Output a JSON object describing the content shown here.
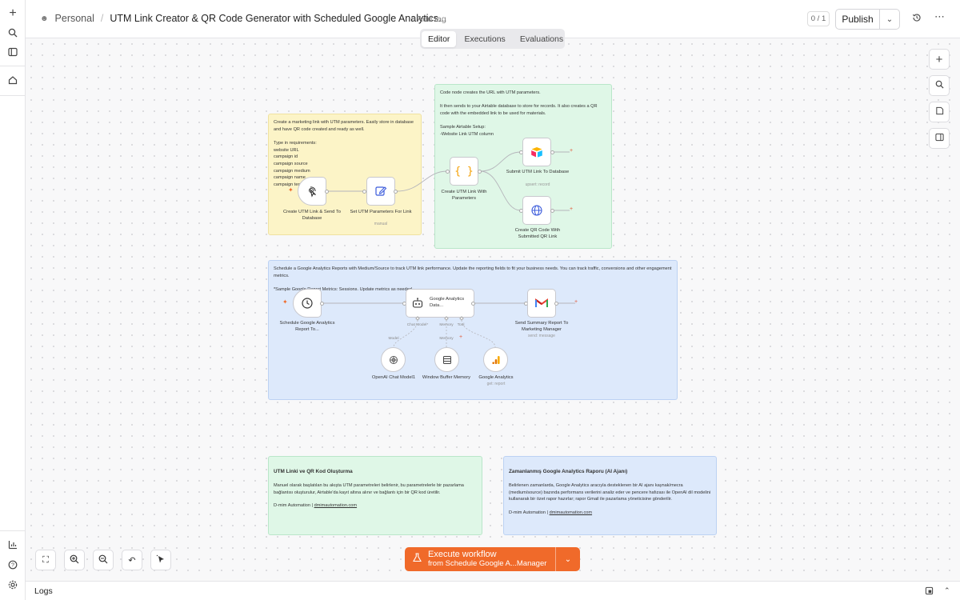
{
  "header": {
    "workspace": "Personal",
    "title": "UTM Link Creator & QR Code Generator with Scheduled Google Analytics...",
    "add_tag": "+ Add tag",
    "counter": "0 / 1",
    "publish": "Publish"
  },
  "tabs": [
    "Editor",
    "Executions",
    "Evaluations"
  ],
  "notes": {
    "yellow": "Create a marketing link with UTM parameters. Easily store in database and have QR code created and ready as well.\n\nType in requirements:\nwebsite URL\ncampaign id\ncampaign source\ncampaign medium\ncampaign name\ncampaign term",
    "green": "Code node creates the URL with UTM parameters.\n\nIt then sends to your Airtable database to store for records. It also creates a QR code with the embedded link to be used for materials.\n\nSample Airtable Setup:\n-Website Link UTM column",
    "blue": "Schedule a Google Analytics Reports with Medium/Source to track UTM link performance. Update the reporting fields to fit your business needs. You can track traffic, conversions and other engagement metrics.\n\n*Sample Google Report Metrics: Sessions. Update metrics as needed",
    "tr1": {
      "title": "UTM Linki ve QR Kod Oluşturma",
      "body": "Manuel olarak başlatılan bu akışta UTM parametreleri belirlenir, bu parametrelerle bir pazarlama bağlantısı oluşturulur, Airtable'da kayıt altına alınır ve bağlantı için bir QR kod üretilir.",
      "footer": "D-mim Automation | ",
      "link": "dmimautomation.com"
    },
    "tr2": {
      "title": "Zamanlanmış Google Analytics Raporu (AI Ajanı)",
      "body": "Belirlenen zamanlarda, Google Analytics aracıyla desteklenen bir AI ajanı kaynak/mecra (medium/source) bazında performans verilerini analiz eder ve pencere hafızası ile OpenAI dil modelini kullanarak bir özet rapor hazırlar; rapor Gmail ile pazarlama yöneticisine gönderilir.",
      "footer": "D-mim Automation | ",
      "link": "dmimautomation.com"
    }
  },
  "nodes": {
    "trigger1": {
      "label": "Create UTM Link & Send To Database",
      "icon": "pointer-click-icon"
    },
    "set": {
      "label": "Set UTM Parameters For Link",
      "sub": "manual",
      "icon": "edit-icon"
    },
    "code": {
      "label": "Create UTM Link With Parameters",
      "icon": "code-braces-icon"
    },
    "airtable": {
      "label": "Submit UTM Link To Database",
      "sub": "upsert: record",
      "icon": "airtable-icon"
    },
    "qr": {
      "label": "Create QR Code With Submitted QR Link",
      "icon": "globe-icon"
    },
    "schedule": {
      "label": "Schedule Google Analytics Report To...",
      "icon": "clock-icon"
    },
    "agent": {
      "label": "Google Analytics Data...",
      "icon": "robot-icon"
    },
    "gmail": {
      "label": "Send Summary Report To Marketing Manager",
      "sub": "send: message",
      "icon": "gmail-icon"
    },
    "openai": {
      "label": "OpenAI Chat Model1",
      "icon": "openai-icon"
    },
    "memory": {
      "label": "Window Buffer Memory",
      "icon": "memory-icon"
    },
    "ga": {
      "label": "Google Analytics",
      "sub": "get: report",
      "icon": "analytics-icon"
    },
    "ports": {
      "chat": "Chat Model*",
      "memory": "Memory",
      "tool": "Tool",
      "model": "Model",
      "memory2": "Memory"
    }
  },
  "execute": {
    "line1": "Execute workflow",
    "line2": "from Schedule Google A...Manager"
  },
  "logs": "Logs",
  "colors": {
    "accent": "#f06a2a",
    "yellow_note": "#fcf4c7",
    "green_note": "#dff7e7",
    "blue_note": "#dde9fb"
  }
}
